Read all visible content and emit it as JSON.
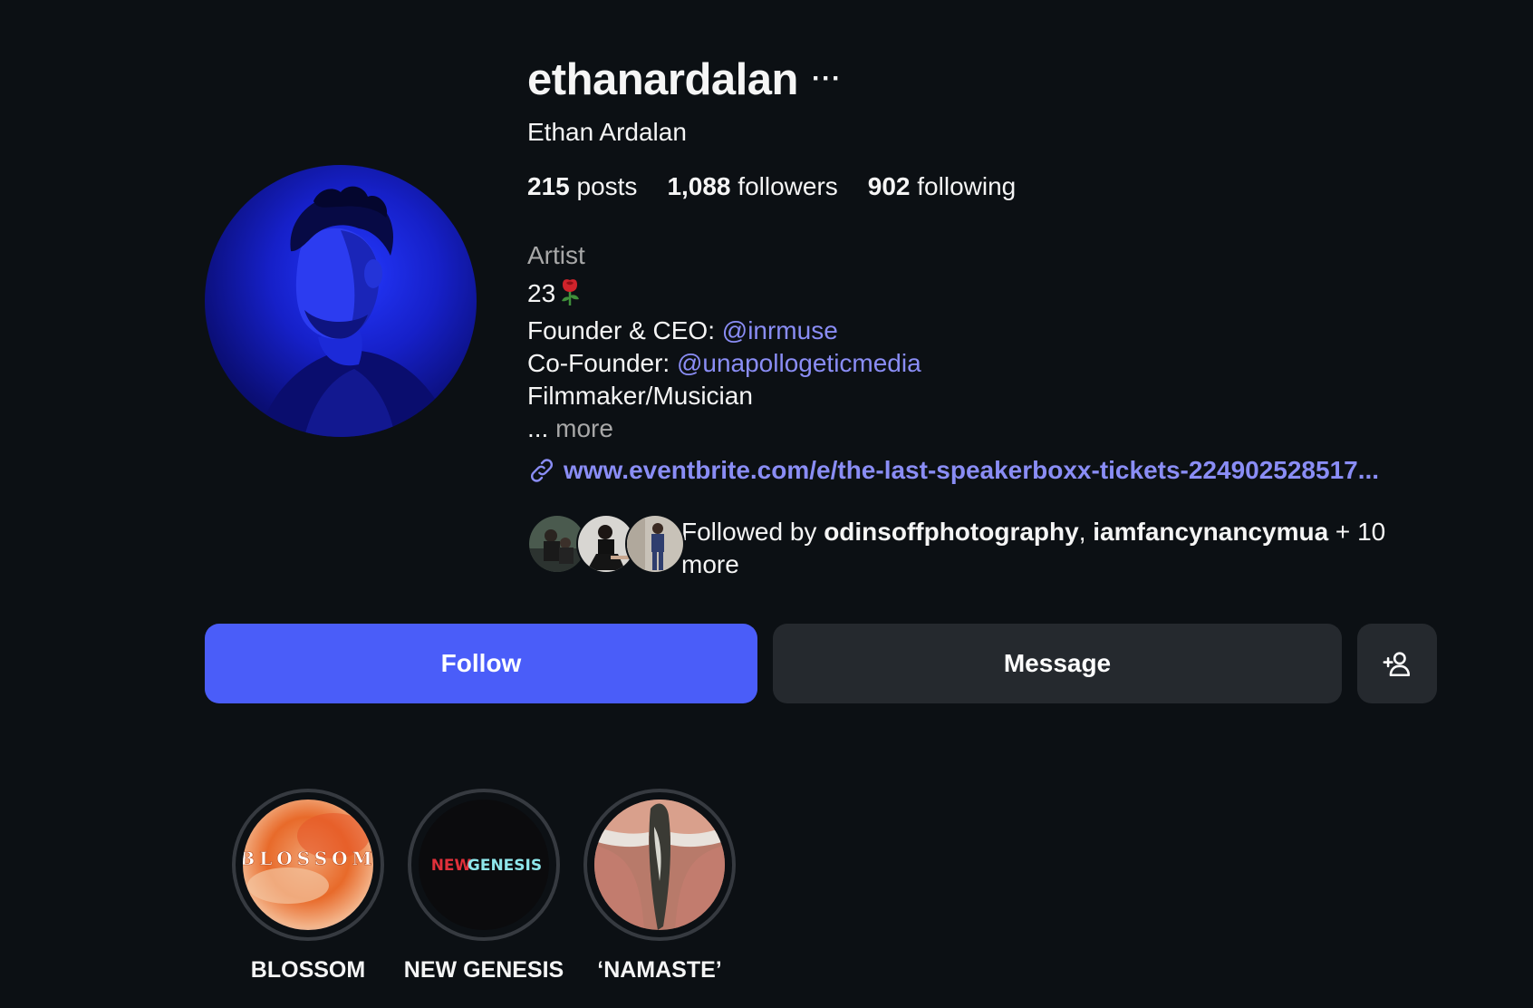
{
  "profile": {
    "username": "ethanardalan",
    "more_options": "···",
    "full_name": "Ethan Ardalan",
    "stats": {
      "posts_count": "215",
      "posts_label": "posts",
      "followers_count": "1,088",
      "followers_label": "followers",
      "following_count": "902",
      "following_label": "following"
    },
    "category": "Artist",
    "bio": {
      "line1": "23",
      "line2_prefix": "Founder & CEO: ",
      "line2_mention": "@inrmuse",
      "line3_prefix": "Co-Founder: ",
      "line3_mention": "@unapollogeticmedia",
      "line4": "Filmmaker/Musician",
      "line5_prefix": "... ",
      "line5_more": "more"
    },
    "link": "www.eventbrite.com/e/the-last-speakerboxx-tickets-224902528517...",
    "followed_by": {
      "prefix": "Followed by ",
      "user1": "odinsoffphotography",
      "separator": ", ",
      "user2": "iamfancynancymua",
      "suffix": " + 10 more"
    }
  },
  "actions": {
    "follow_label": "Follow",
    "message_label": "Message",
    "suggest_icon": "add-person-icon"
  },
  "highlights": [
    {
      "label": "BLOSSOM",
      "cover_text": "BLOSSOM"
    },
    {
      "label": "NEW GENESIS",
      "cover_text_1": "NEW",
      "cover_text_2": "GENESIS"
    },
    {
      "label": "‘NAMASTE’"
    }
  ],
  "colors": {
    "background": "#0c1014",
    "accent": "#4a5df9",
    "link": "#8a8df5",
    "secondary_button": "#25292e",
    "muted_text": "#a8a8a8"
  }
}
